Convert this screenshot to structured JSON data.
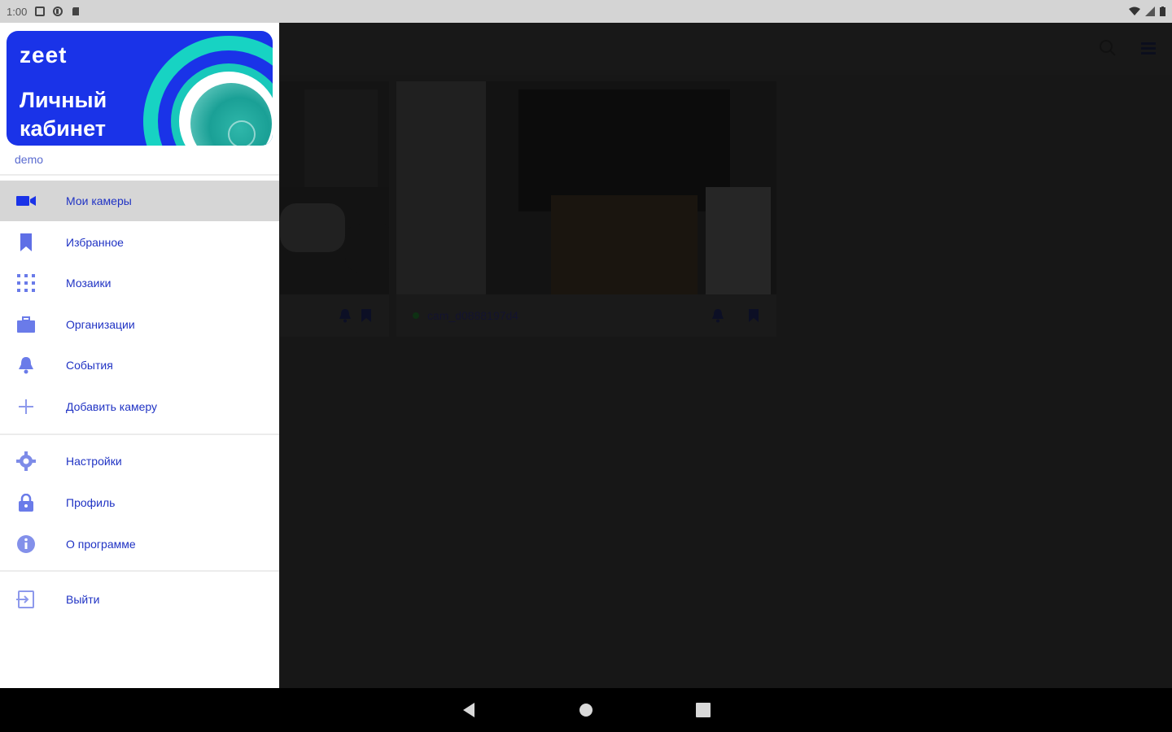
{
  "status_bar": {
    "time": "1:00"
  },
  "drawer": {
    "logo": "zeet",
    "banner_title_line1": "Личный",
    "banner_title_line2": "кабинет",
    "username": "demo",
    "items": [
      {
        "label": "Мои камеры",
        "icon": "videocam-icon"
      },
      {
        "label": "Избранное",
        "icon": "bookmark-icon"
      },
      {
        "label": "Мозаики",
        "icon": "grid-icon"
      },
      {
        "label": "Организации",
        "icon": "briefcase-icon"
      },
      {
        "label": "События",
        "icon": "bell-icon"
      },
      {
        "label": "Добавить камеру",
        "icon": "plus-icon"
      },
      {
        "label": "Настройки",
        "icon": "gear-icon"
      },
      {
        "label": "Профиль",
        "icon": "lock-icon"
      },
      {
        "label": "О программе",
        "icon": "info-icon"
      },
      {
        "label": "Выйти",
        "icon": "logout-icon"
      }
    ]
  },
  "main": {
    "cards": [
      {
        "title": ""
      },
      {
        "title": "cam_d0888197d4"
      }
    ]
  },
  "colors": {
    "accent": "#2033c4",
    "banner": "#1a33e8",
    "teal": "#17d3c3"
  }
}
